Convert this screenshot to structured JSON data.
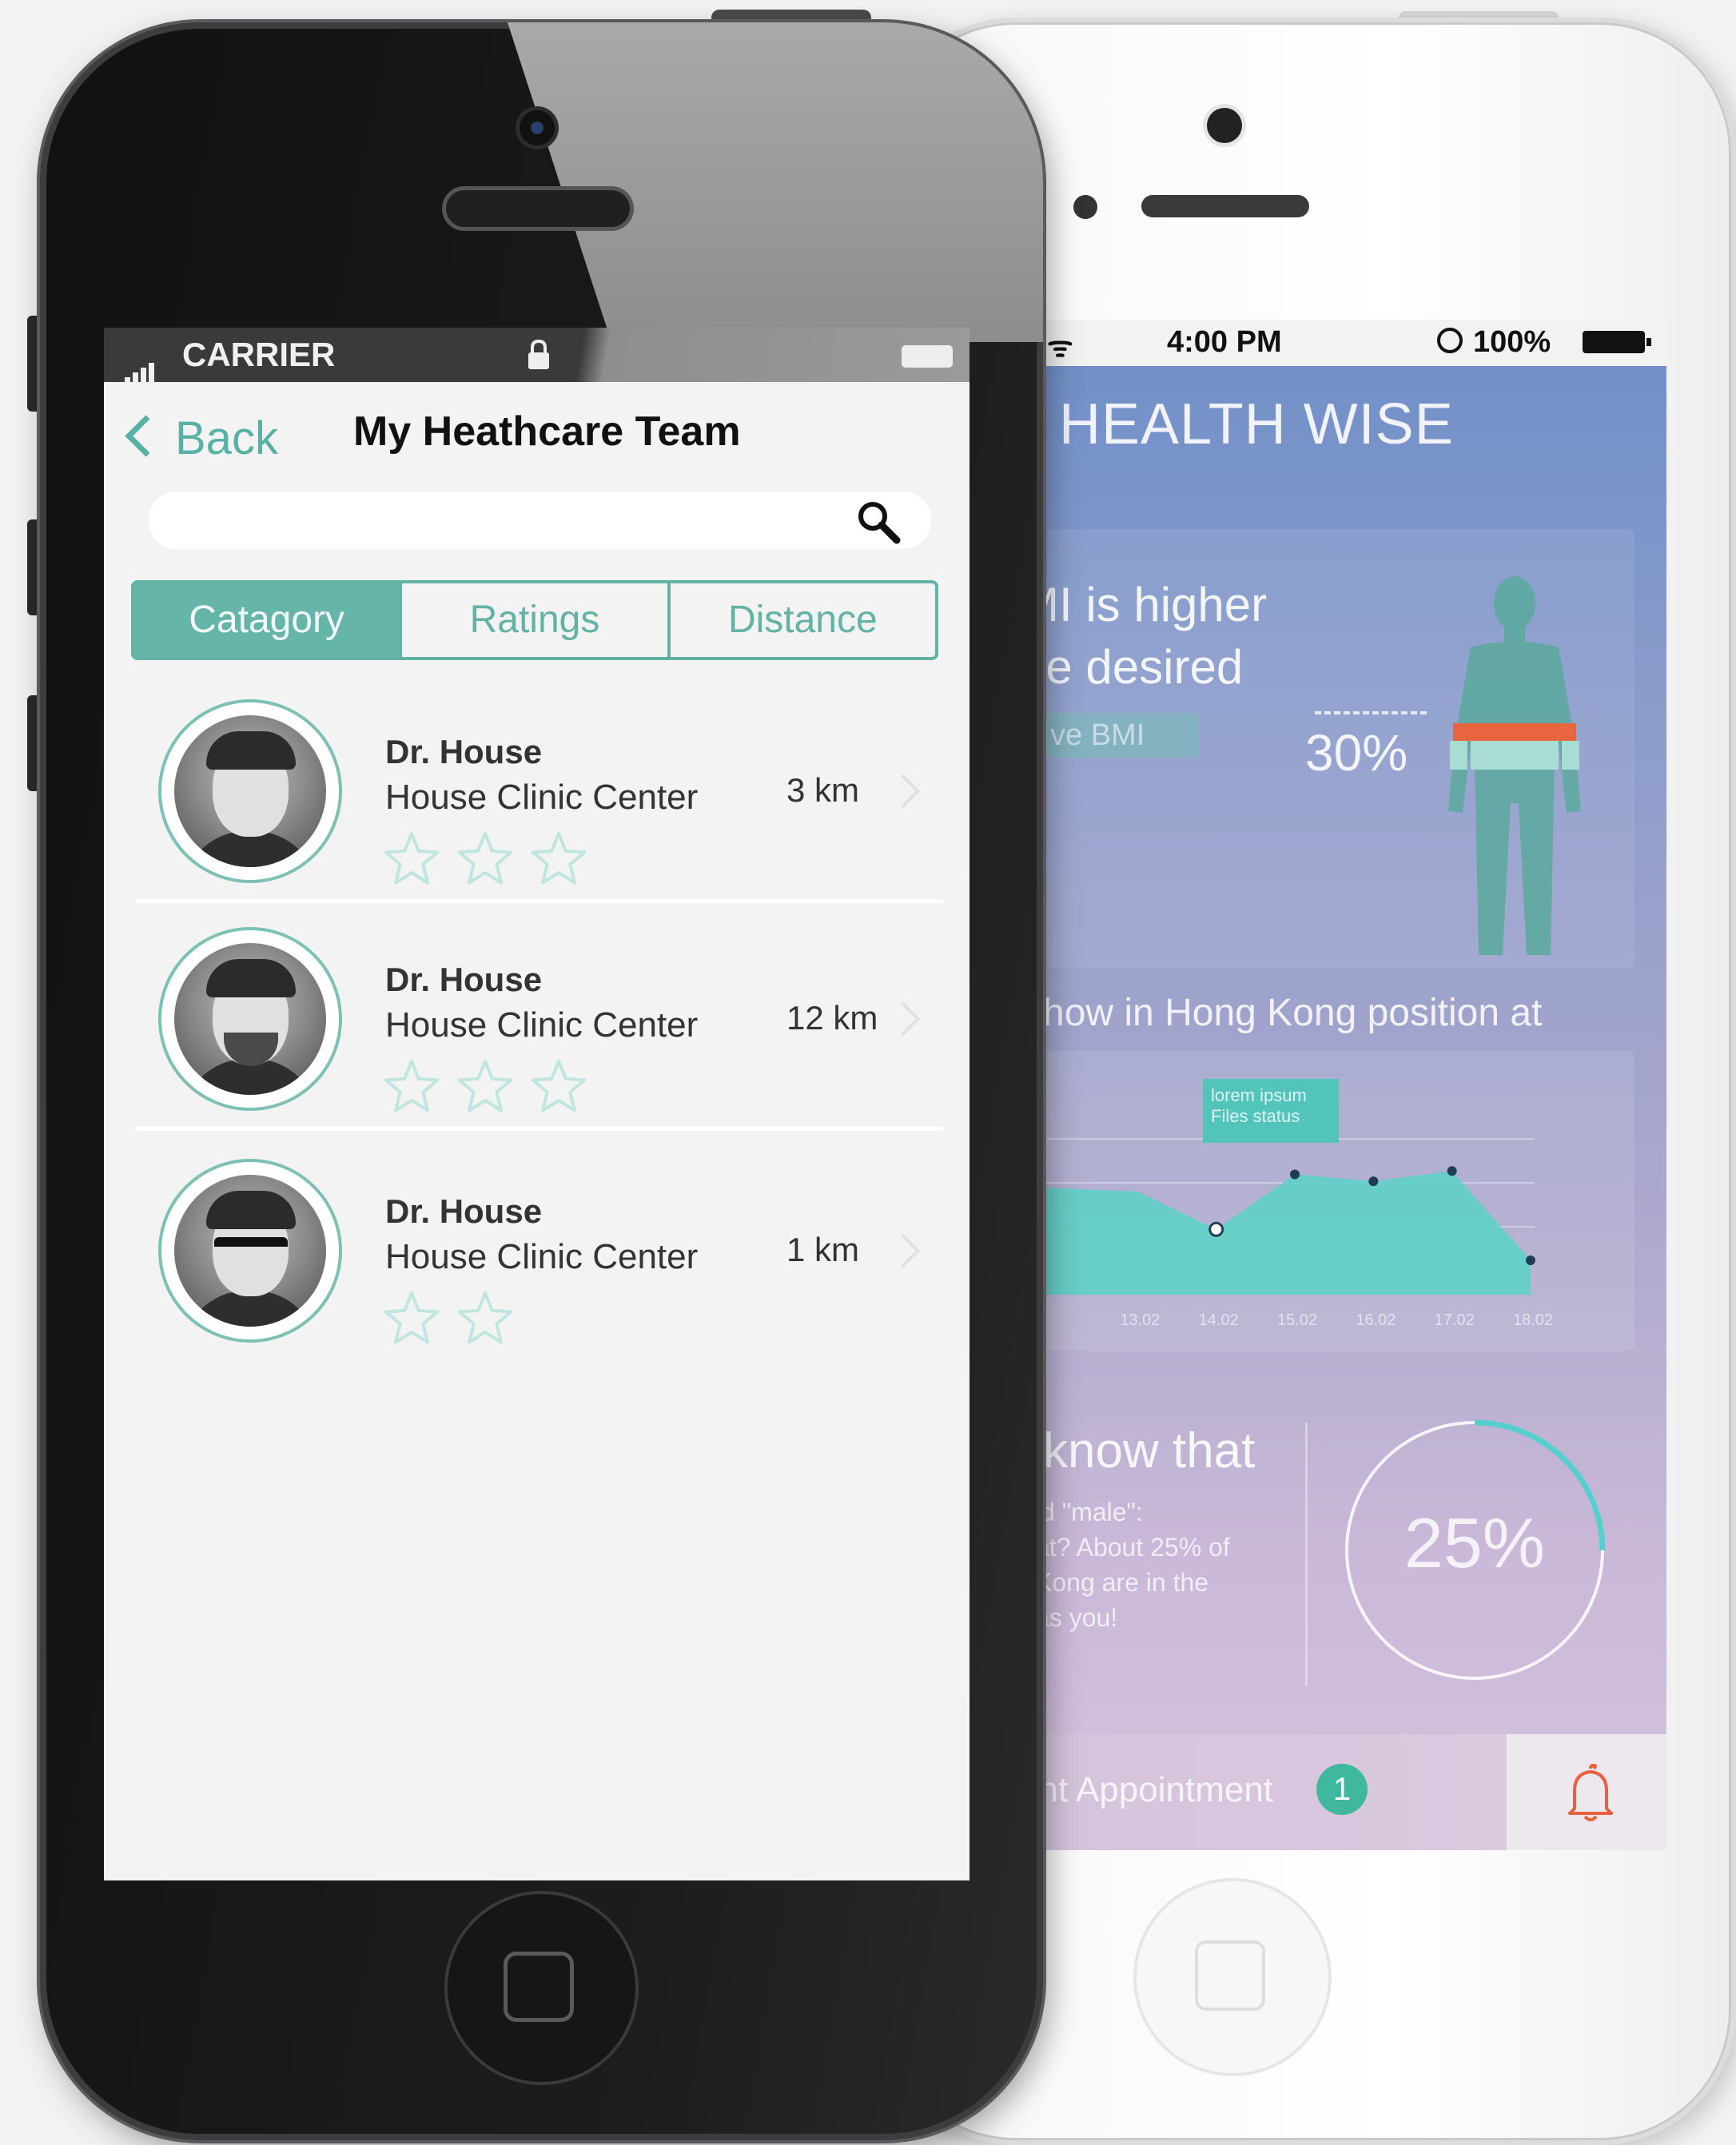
{
  "left_phone": {
    "status_bar": {
      "carrier": "CARRIER"
    },
    "nav": {
      "back_label": "Back",
      "title": "My Heathcare Team"
    },
    "search": {
      "placeholder": ""
    },
    "tabs": [
      {
        "label": "Catagory",
        "active": true
      },
      {
        "label": "Ratings",
        "active": false
      },
      {
        "label": "Distance",
        "active": false
      }
    ],
    "doctors": [
      {
        "name": "Dr. House",
        "clinic": "House Clinic Center",
        "distance": "3 km",
        "rating": 3
      },
      {
        "name": "Dr. House",
        "clinic": "House Clinic Center",
        "distance": "12 km",
        "rating": 3
      },
      {
        "name": "Dr. House",
        "clinic": "House Clinic Center",
        "distance": "1 km",
        "rating": 2
      }
    ]
  },
  "right_phone": {
    "status_bar": {
      "time": "4:00 PM",
      "battery": "100%"
    },
    "app_title": "HEALTH WISE",
    "bmi": {
      "text": "MI is higher\nhe desired",
      "pill_label": "ve BMI",
      "percent": "30%"
    },
    "hk_text": "how in Hong Kong position at",
    "chart_data": {
      "type": "area",
      "x": [
        "",
        "13.02",
        "14.02",
        "15.02",
        "16.02",
        "17.02",
        "18.02"
      ],
      "y_relative": [
        0.62,
        0.6,
        0.38,
        0.7,
        0.66,
        0.72,
        0.2
      ],
      "tooltip": [
        "lorem ipsum",
        "Files status"
      ]
    },
    "know": {
      "title": "know that",
      "body": "id \"male\":\nat? About 25% of\nKong are in the\n as you!",
      "percent_label": "25%",
      "ring_fraction": 0.25
    },
    "appointment": {
      "label": "ent Appointment",
      "badge": "1"
    },
    "colors": {
      "accent": "#62b2a6",
      "teal": "#5fd0c6",
      "alert": "#e8603c"
    }
  }
}
